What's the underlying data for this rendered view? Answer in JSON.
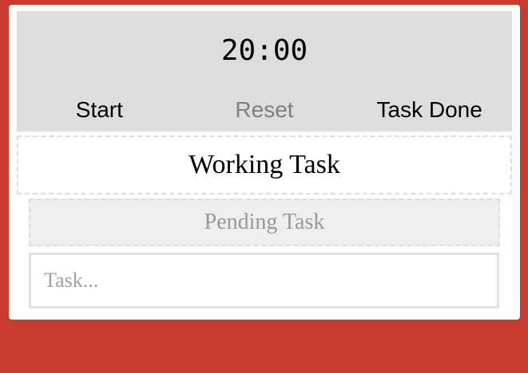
{
  "theme": {
    "background": "#c83c2f",
    "panel": "#dddddd",
    "pending_background": "#eeeeee"
  },
  "timer": {
    "display": "20:00"
  },
  "controls": {
    "start_label": "Start",
    "reset_label": "Reset",
    "task_done_label": "Task Done"
  },
  "tasks": {
    "working": "Working Task",
    "pending": "Pending Task"
  },
  "task_input": {
    "placeholder": "Task...",
    "value": ""
  }
}
